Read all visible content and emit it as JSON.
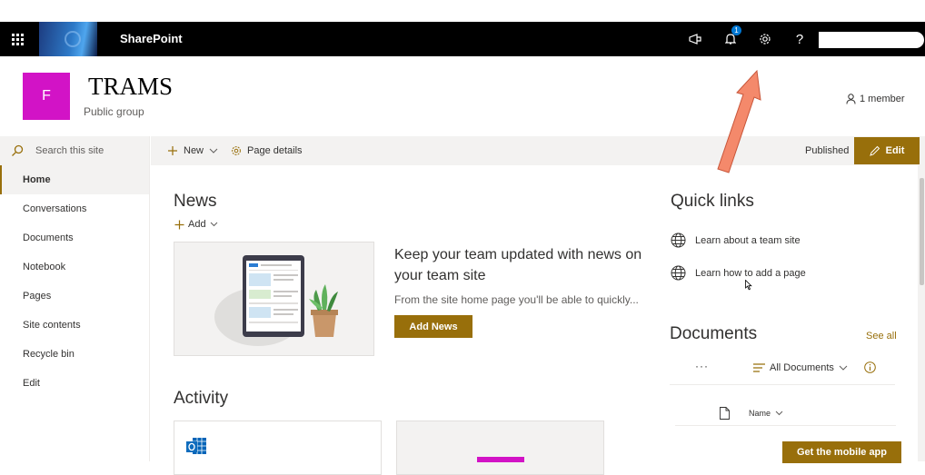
{
  "suite": {
    "app_name": "SharePoint",
    "notification_count": "1",
    "icons": [
      "waffle-icon",
      "megaphone-icon",
      "bell-icon",
      "gear-icon",
      "help-icon",
      "avatar"
    ]
  },
  "site": {
    "logo_letter": "F",
    "title": "TRAMS",
    "subtitle": "Public group",
    "members": "1 member",
    "logo_color": "#d213c6"
  },
  "sidebar": {
    "search_placeholder": "Search this site",
    "items": [
      {
        "label": "Home",
        "active": true
      },
      {
        "label": "Conversations"
      },
      {
        "label": "Documents"
      },
      {
        "label": "Notebook"
      },
      {
        "label": "Pages"
      },
      {
        "label": "Site contents"
      },
      {
        "label": "Recycle bin"
      },
      {
        "label": "Edit"
      }
    ]
  },
  "commandbar": {
    "new_label": "New",
    "page_details_label": "Page details",
    "status": "Published",
    "edit_label": "Edit"
  },
  "news": {
    "title": "News",
    "add_label": "Add",
    "headline": "Keep your team updated with news on your team site",
    "description": "From the site home page you'll be able to quickly...",
    "button_label": "Add News"
  },
  "activity": {
    "title": "Activity"
  },
  "quick_links": {
    "title": "Quick links",
    "items": [
      {
        "label": "Learn about a team site"
      },
      {
        "label": "Learn how to add a page"
      }
    ]
  },
  "documents": {
    "title": "Documents",
    "see_all": "See all",
    "more": "···",
    "view_label": "All Documents",
    "column_name": "Name",
    "mobile_button": "Get the mobile app"
  },
  "colors": {
    "accent": "#986f0b",
    "suitebar": "#000000",
    "annotation_arrow": "#f4896b"
  }
}
